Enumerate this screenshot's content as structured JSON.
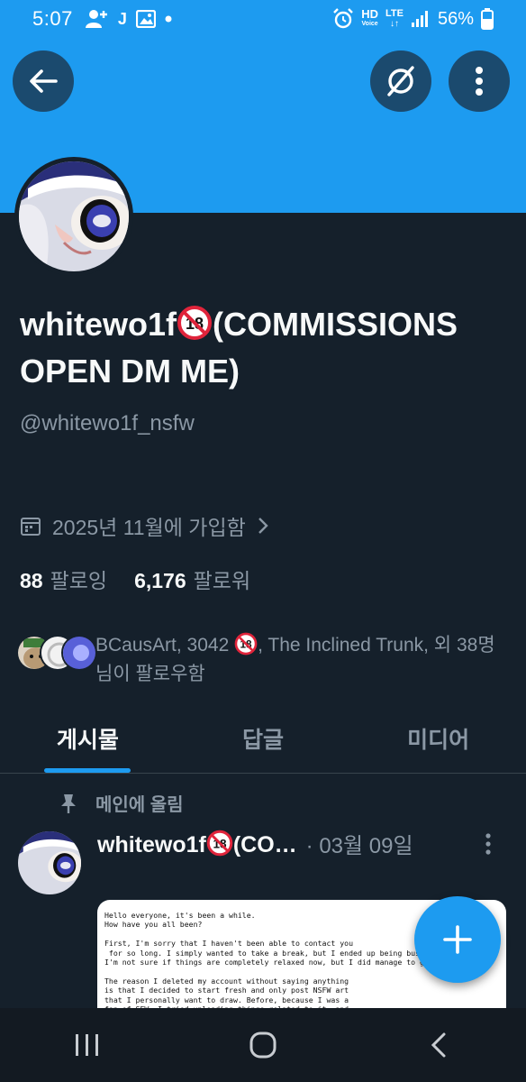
{
  "status_bar": {
    "time": "5:07",
    "left_glyph_j": "J",
    "network_hd": "HD",
    "network_voice": "Voice",
    "network_lte": "LTE",
    "battery": "56%"
  },
  "profile": {
    "display_name_start": "whitewo1f",
    "display_name_rest": "(COMMISSIONS OPEN DM ME)",
    "handle": "@whitewo1f_nsfw",
    "joined": "2025년 11월에 가입함",
    "following_count": "88",
    "following_label": "팔로잉",
    "followers_count": "6,176",
    "followers_label": "팔로워",
    "known_followers_a": "BCausArt, 3042 ",
    "known_followers_b": ", The Inclined Trunk, 외 38명 님이 팔로우함"
  },
  "tabs": [
    {
      "label": "게시물"
    },
    {
      "label": "답글"
    },
    {
      "label": "미디어"
    }
  ],
  "post": {
    "pinned_label": "메인에 올림",
    "author_start": "whitewo1f",
    "author_rest": "(CO…",
    "date": "· 03월 09일",
    "media_text": "Hello everyone, it's been a while.\nHow have you all been?\n\nFirst, I'm sorry that I haven't been able to contact you\n for so long. I simply wanted to take a break, but I ended up being busy.\nI'm not sure if things are completely relaxed now, but I did manage to get\n\nThe reason I deleted my account without saying anything\nis that I decided to start fresh and only post NSFW art\nthat I personally want to draw. Before, because I was a\nfan of SFW, I tried uploading things related to it, and"
  },
  "colors": {
    "accent": "#1d9bf0",
    "background": "#15202b",
    "secondary_text": "#8b98a5"
  }
}
